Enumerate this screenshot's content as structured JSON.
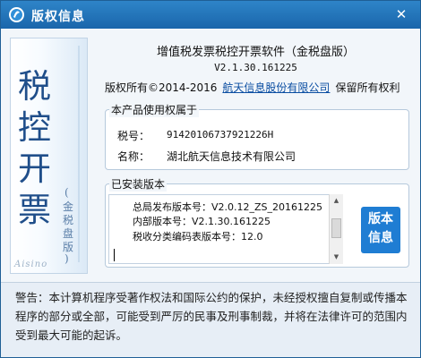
{
  "window": {
    "title": "版权信息",
    "close_glyph": "✕"
  },
  "left_panel": {
    "big_text": [
      "税",
      "控",
      "开",
      "票"
    ],
    "sub_text": [
      "(",
      "金",
      "税",
      "盘",
      "版",
      ")"
    ],
    "logo_text": "Aisino"
  },
  "product": {
    "name": "增值税发票税控开票软件（金税盘版）",
    "version": "V2.1.30.161225",
    "copyright_prefix": "版权所有©2014-2016",
    "company_link": "航天信息股份有限公司",
    "copyright_suffix": "保留所有权利"
  },
  "owner": {
    "title": "本产品使用权属于",
    "tax_label": "税号：",
    "tax_value": "91420106737921226H",
    "name_label": "名称：",
    "name_value": "湖北航天信息技术有限公司"
  },
  "installed": {
    "title": "已安装版本",
    "lines": [
      "总局发布版本号：V2.0.12_ZS_20161225",
      "内部版本号：V2.1.30.161225",
      "税收分类编码表版本号：12.0"
    ],
    "button_line1": "版本",
    "button_line2": "信息"
  },
  "warning": {
    "text": "警告：本计算机程序受著作权法和国际公约的保护，未经授权擅自复制或传播本程序的部分或全部，可能受到严厉的民事及刑事制裁，并将在法律许可的范围内受到最大可能的起诉。"
  },
  "colors": {
    "titlebar": "#1f6db4",
    "accent_button": "#1f7dd3",
    "link": "#0b4ea2",
    "calligraphy": "#1f4e8a"
  }
}
